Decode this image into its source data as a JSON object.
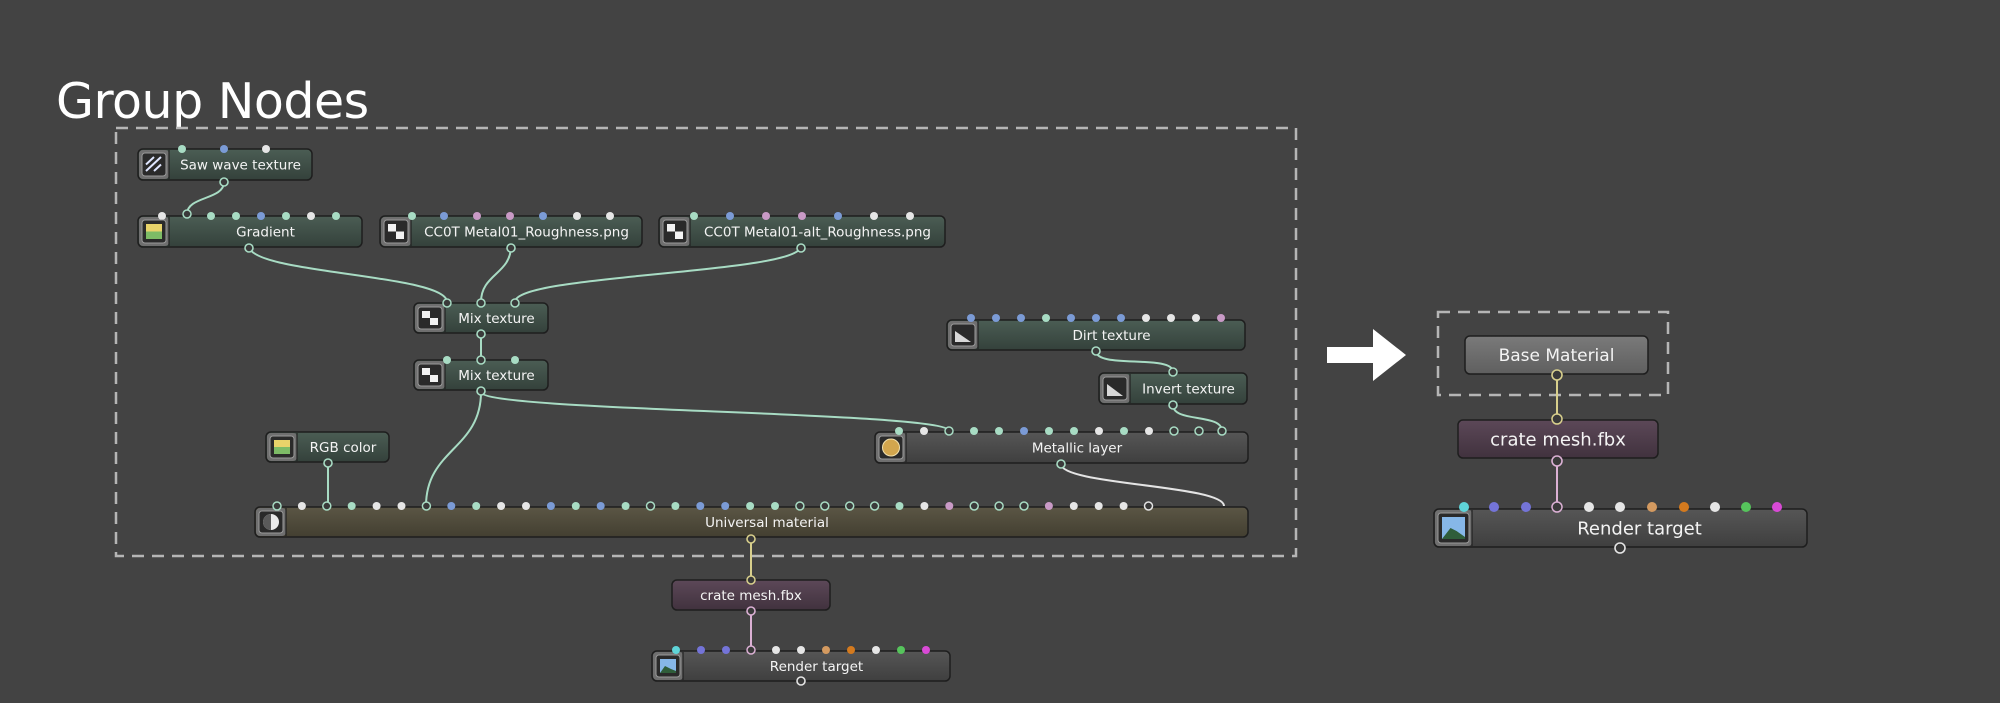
{
  "page": {
    "title": "Group Nodes"
  },
  "colors": {
    "background": "#434343",
    "group_outline": "#b5b5b5",
    "node_green": "#3d4c45",
    "node_gray": "#4a4a4a",
    "node_olive": "#4f4b3c",
    "node_purple": "#4d3c4a",
    "node_base": "#6a6a6a",
    "wire_green": "#a8dcc4",
    "wire_white": "#e4e4e4",
    "wire_yellow": "#d8cf8c",
    "wire_pink": "#dbb0d4",
    "arrow": "#ffffff"
  },
  "expanded_graph": {
    "nodes": {
      "saw_wave": {
        "label": "Saw wave texture",
        "icon": "procedural-texture-icon"
      },
      "gradient": {
        "label": "Gradient",
        "icon": "gradient-icon"
      },
      "cc0_rough": {
        "label": "CC0T Metal01_Roughness.png",
        "icon": "image-texture-icon"
      },
      "cc0_alt_rough": {
        "label": "CC0T Metal01-alt_Roughness.png",
        "icon": "image-texture-icon"
      },
      "mix1": {
        "label": "Mix texture",
        "icon": "mix-texture-icon"
      },
      "mix2": {
        "label": "Mix texture",
        "icon": "mix-texture-icon"
      },
      "dirt": {
        "label": "Dirt texture",
        "icon": "dirt-texture-icon"
      },
      "invert": {
        "label": "Invert texture",
        "icon": "invert-texture-icon"
      },
      "rgb": {
        "label": "RGB color",
        "icon": "rgb-color-icon"
      },
      "metallic": {
        "label": "Metallic layer",
        "icon": "metallic-sphere-icon"
      },
      "universal": {
        "label": "Universal material",
        "icon": "material-sphere-icon"
      },
      "crate": {
        "label": "crate mesh.fbx"
      },
      "render": {
        "label": "Render target",
        "icon": "landscape-image-icon"
      }
    }
  },
  "collapsed_graph": {
    "nodes": {
      "base_material": {
        "label": "Base Material"
      },
      "crate": {
        "label": "crate mesh.fbx"
      },
      "render": {
        "label": "Render target",
        "icon": "landscape-image-icon"
      }
    }
  }
}
